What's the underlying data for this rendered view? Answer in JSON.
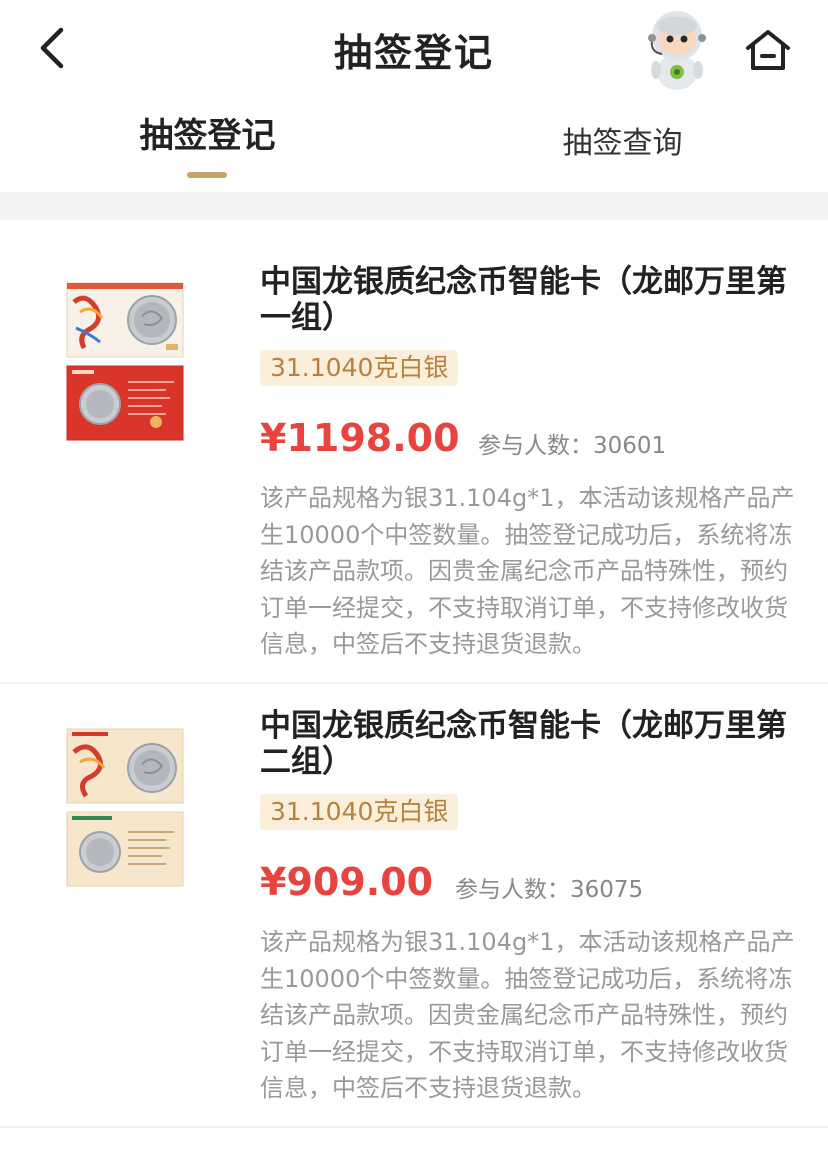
{
  "header": {
    "title": "抽签登记"
  },
  "tabs": [
    {
      "label": "抽签登记",
      "active": true
    },
    {
      "label": "抽签查询",
      "active": false
    }
  ],
  "products": [
    {
      "title": "中国龙银质纪念币智能卡（龙邮万里第一组）",
      "spec": "31.1040克白银",
      "price": "¥1198.00",
      "participants": "参与人数：30601",
      "description": "该产品规格为银31.104g*1，本活动该规格产品产生10000个中签数量。抽签登记成功后，系统将冻结该产品款项。因贵金属纪念币产品特殊性，预约订单一经提交，不支持取消订单，不支持修改收货信息，中签后不支持退货退款。"
    },
    {
      "title": "中国龙银质纪念币智能卡（龙邮万里第二组）",
      "spec": "31.1040克白银",
      "price": "¥909.00",
      "participants": "参与人数：36075",
      "description": "该产品规格为银31.104g*1，本活动该规格产品产生10000个中签数量。抽签登记成功后，系统将冻结该产品款项。因贵金属纪念币产品特殊性，预约订单一经提交，不支持取消订单，不支持修改收货信息，中签后不支持退货退款。"
    }
  ],
  "colors": {
    "accent": "#c8a365",
    "price": "#e8433e",
    "badge_bg": "#fbeedb",
    "badge_text": "#b7813e"
  },
  "icons": {
    "back": "chevron-left-icon",
    "assistant": "robot-assistant-icon",
    "home": "home-icon"
  }
}
